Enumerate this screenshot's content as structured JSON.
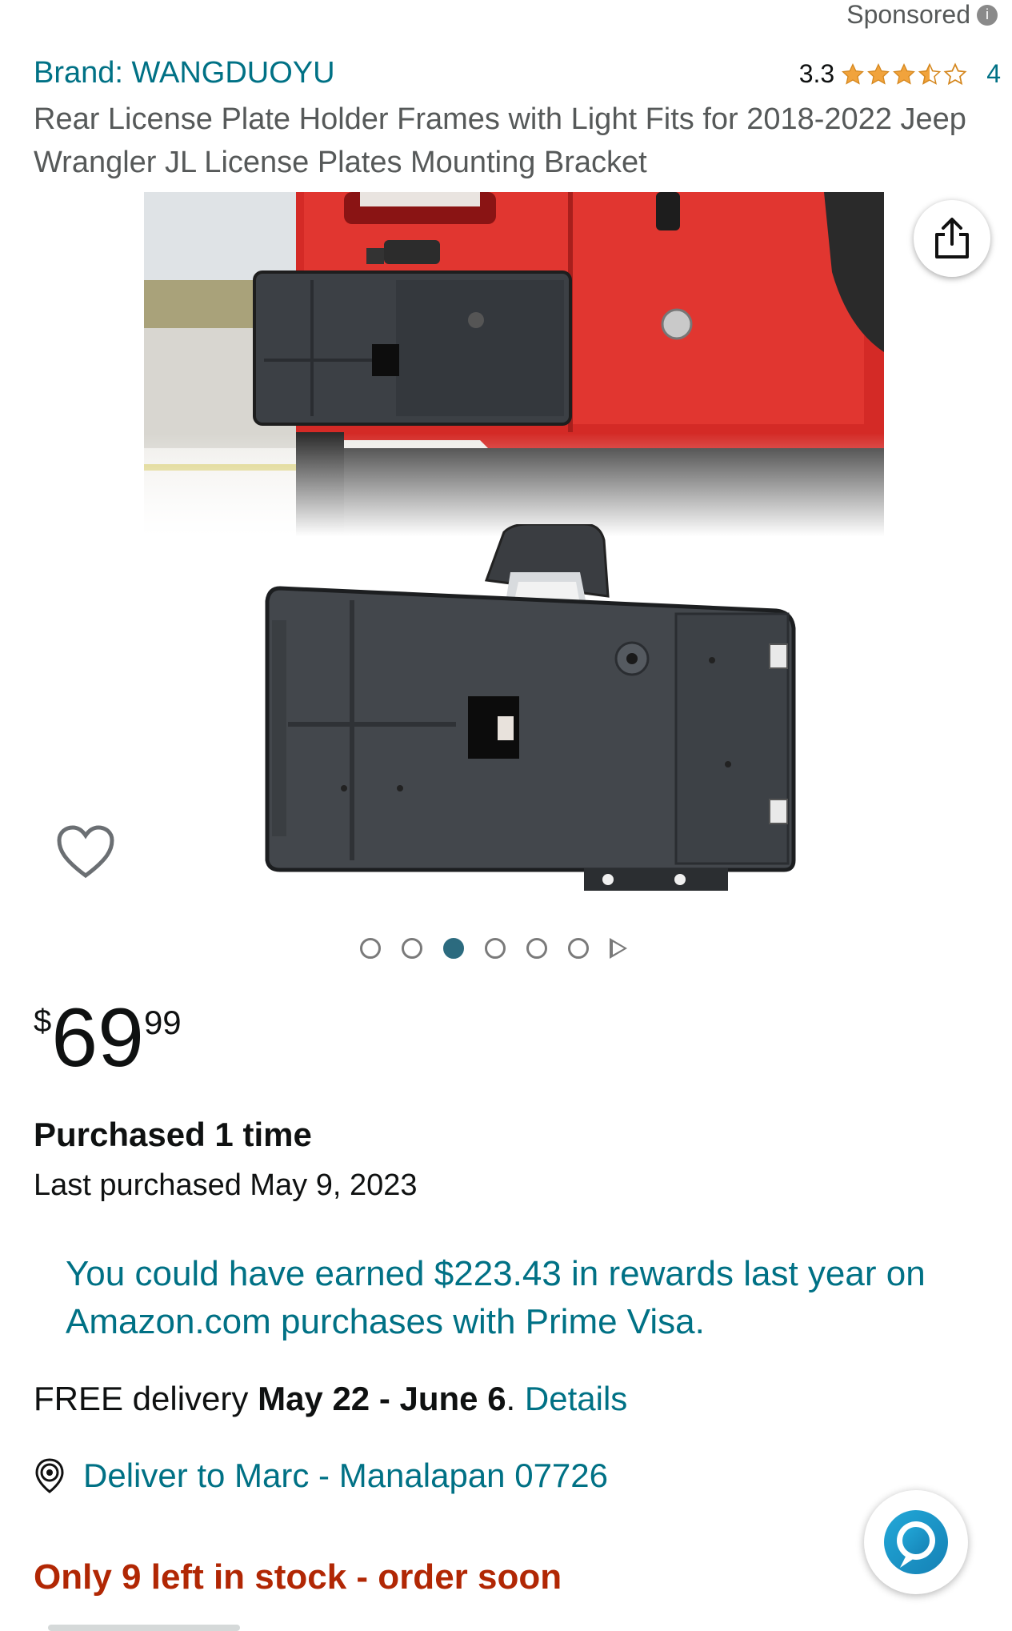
{
  "header": {
    "sponsored_label": "Sponsored",
    "info_icon": "i"
  },
  "product": {
    "brand": "Brand: WANGDUOYU",
    "rating_value": "3.3",
    "rating_stars": 3.5,
    "rating_count": "4",
    "title": "Rear License Plate Holder Frames with Light Fits for 2018-2022 Jeep Wrangler JL License Plates Mounting Bracket"
  },
  "gallery": {
    "image_count": 6,
    "active_index": 2
  },
  "price": {
    "symbol": "$",
    "whole": "69",
    "fraction": "99"
  },
  "purchase_history": {
    "purchased": "Purchased 1 time",
    "last_purchased": "Last purchased May 9, 2023"
  },
  "rewards": {
    "text": "You could have earned $223.43 in rewards last year on Amazon.com purchases with Prime Visa."
  },
  "delivery": {
    "prefix": "FREE delivery ",
    "dates": "May 22 - June 6",
    "suffix": ". ",
    "details_link": "Details",
    "deliver_to": "Deliver to Marc - Manalapan 07726"
  },
  "stock": {
    "text": "Only 9 left in stock - order soon"
  },
  "colors": {
    "link": "#007185",
    "stock_red": "#b12704",
    "star": "#f1a33c",
    "active_dot": "#2c6b7f"
  }
}
